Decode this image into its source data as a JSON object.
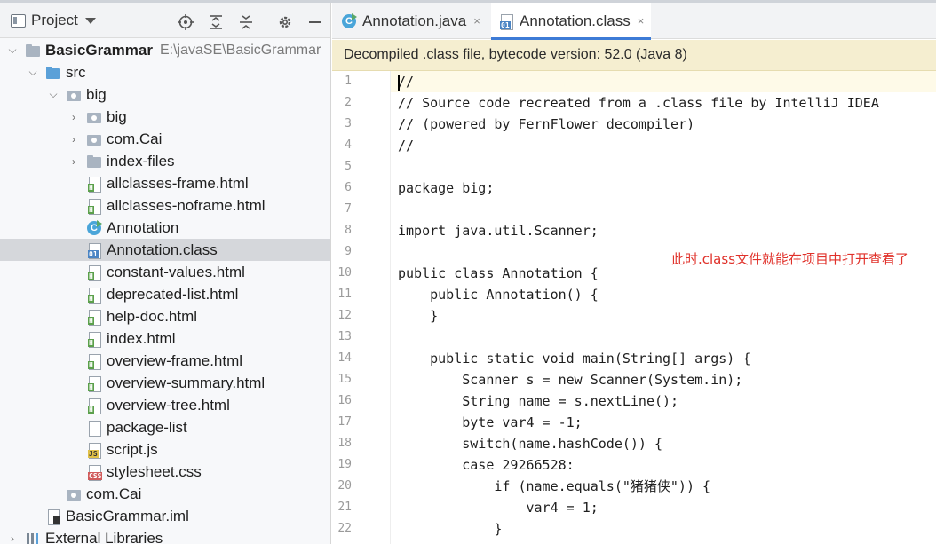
{
  "project_panel": {
    "title": "Project",
    "tree": [
      {
        "label": "BasicGrammar",
        "path": "E:\\javaSE\\BasicGrammar",
        "icon": "module-folder-icon",
        "arrow": "down"
      },
      {
        "label": "src",
        "icon": "source-folder-icon",
        "arrow": "down"
      },
      {
        "label": "big",
        "icon": "package-icon",
        "arrow": "down"
      },
      {
        "label": "big",
        "icon": "package-icon",
        "arrow": "right"
      },
      {
        "label": "com.Cai",
        "icon": "package-icon",
        "arrow": "right"
      },
      {
        "label": "index-files",
        "icon": "folder-icon",
        "arrow": "right"
      },
      {
        "label": "allclasses-frame.html",
        "icon": "html-file-icon"
      },
      {
        "label": "allclasses-noframe.html",
        "icon": "html-file-icon"
      },
      {
        "label": "Annotation",
        "icon": "java-class-icon"
      },
      {
        "label": "Annotation.class",
        "icon": "class-file-icon"
      },
      {
        "label": "constant-values.html",
        "icon": "html-file-icon"
      },
      {
        "label": "deprecated-list.html",
        "icon": "html-file-icon"
      },
      {
        "label": "help-doc.html",
        "icon": "html-file-icon"
      },
      {
        "label": "index.html",
        "icon": "html-file-icon"
      },
      {
        "label": "overview-frame.html",
        "icon": "html-file-icon"
      },
      {
        "label": "overview-summary.html",
        "icon": "html-file-icon"
      },
      {
        "label": "overview-tree.html",
        "icon": "html-file-icon"
      },
      {
        "label": "package-list",
        "icon": "text-file-icon"
      },
      {
        "label": "script.js",
        "icon": "js-file-icon"
      },
      {
        "label": "stylesheet.css",
        "icon": "css-file-icon"
      },
      {
        "label": "com.Cai",
        "icon": "package-icon"
      },
      {
        "label": "BasicGrammar.iml",
        "icon": "iml-file-icon"
      },
      {
        "label": "External Libraries",
        "icon": "library-icon",
        "arrow": "right"
      }
    ]
  },
  "editor": {
    "tabs": [
      {
        "label": "Annotation.java",
        "icon": "java-class-icon",
        "close": "×"
      },
      {
        "label": "Annotation.class",
        "icon": "class-file-icon",
        "close": "×",
        "active": true
      }
    ],
    "banner": "Decompiled .class file, bytecode version: 52.0 (Java 8)",
    "lines": [
      {
        "n": "1",
        "text": "//"
      },
      {
        "n": "2",
        "text": "// Source code recreated from a .class file by IntelliJ IDEA"
      },
      {
        "n": "3",
        "text": "// (powered by FernFlower decompiler)"
      },
      {
        "n": "4",
        "text": "//"
      },
      {
        "n": "5",
        "text": ""
      },
      {
        "n": "6",
        "text": "package big;"
      },
      {
        "n": "7",
        "text": ""
      },
      {
        "n": "8",
        "text": "import java.util.Scanner;"
      },
      {
        "n": "9",
        "text": ""
      },
      {
        "n": "10",
        "text": "public class Annotation {"
      },
      {
        "n": "11",
        "text": "    public Annotation() {"
      },
      {
        "n": "12",
        "text": "    }"
      },
      {
        "n": "13",
        "text": ""
      },
      {
        "n": "14",
        "text": "    public static void main(String[] args) {"
      },
      {
        "n": "15",
        "text": "        Scanner s = new Scanner(System.in);"
      },
      {
        "n": "16",
        "text": "        String name = s.nextLine();"
      },
      {
        "n": "17",
        "text": "        byte var4 = -1;"
      },
      {
        "n": "18",
        "text": "        switch(name.hashCode()) {"
      },
      {
        "n": "19",
        "text": "        case 29266528:"
      },
      {
        "n": "20",
        "text": "            if (name.equals(\"猪猪侠\")) {"
      },
      {
        "n": "21",
        "text": "                var4 = 1;"
      },
      {
        "n": "22",
        "text": "            }"
      }
    ],
    "note": "此时.class文件就能在项目中打开查看了"
  }
}
